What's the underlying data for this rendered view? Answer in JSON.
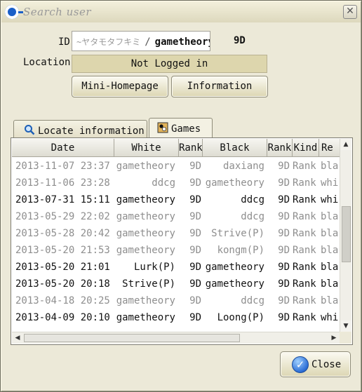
{
  "window": {
    "title": "Search user"
  },
  "user": {
    "id_label": "ID",
    "id_prefix": "~ヤタモタフキミ",
    "id_separator": "/",
    "username": "gametheory",
    "rank": "9D",
    "location_label": "Location",
    "location_value": "Not Logged in"
  },
  "buttons": {
    "mini_homepage": "Mini-Homepage",
    "information": "Information",
    "close": "Close"
  },
  "tabs": [
    {
      "label": "Locate information",
      "icon": "magnifier-icon",
      "active": false
    },
    {
      "label": "Games",
      "icon": "go-board-icon",
      "active": true
    }
  ],
  "table": {
    "columns": [
      "Date",
      "White",
      "Rank",
      "Black",
      "Rank",
      "Kind",
      "Re"
    ],
    "rows": [
      {
        "date": "2013-11-07 23:37",
        "white": "gametheory",
        "white_rank": "9D",
        "black": "daxiang",
        "black_rank": "9D",
        "kind": "Rank",
        "result": "bla",
        "dim": true
      },
      {
        "date": "2013-11-06 23:28",
        "white": "ddcg",
        "white_rank": "9D",
        "black": "gametheory",
        "black_rank": "9D",
        "kind": "Rank",
        "result": "whi",
        "dim": true
      },
      {
        "date": "2013-07-31 15:11",
        "white": "gametheory",
        "white_rank": "9D",
        "black": "ddcg",
        "black_rank": "9D",
        "kind": "Rank",
        "result": "whi",
        "dim": false
      },
      {
        "date": "2013-05-29 22:02",
        "white": "gametheory",
        "white_rank": "9D",
        "black": "ddcg",
        "black_rank": "9D",
        "kind": "Rank",
        "result": "bla",
        "dim": true
      },
      {
        "date": "2013-05-28 20:42",
        "white": "gametheory",
        "white_rank": "9D",
        "black": "Strive(P)",
        "black_rank": "9D",
        "kind": "Rank",
        "result": "bla",
        "dim": true
      },
      {
        "date": "2013-05-20 21:53",
        "white": "gametheory",
        "white_rank": "9D",
        "black": "kongm(P)",
        "black_rank": "9D",
        "kind": "Rank",
        "result": "bla",
        "dim": true
      },
      {
        "date": "2013-05-20 21:01",
        "white": "Lurk(P)",
        "white_rank": "9D",
        "black": "gametheory",
        "black_rank": "9D",
        "kind": "Rank",
        "result": "bla",
        "dim": false
      },
      {
        "date": "2013-05-20 20:18",
        "white": "Strive(P)",
        "white_rank": "9D",
        "black": "gametheory",
        "black_rank": "9D",
        "kind": "Rank",
        "result": "bla",
        "dim": false
      },
      {
        "date": "2013-04-18 20:25",
        "white": "gametheory",
        "white_rank": "9D",
        "black": "ddcg",
        "black_rank": "9D",
        "kind": "Rank",
        "result": "bla",
        "dim": true
      },
      {
        "date": "2013-04-09 20:10",
        "white": "gametheory",
        "white_rank": "9D",
        "black": "Loong(P)",
        "black_rank": "9D",
        "kind": "Rank",
        "result": "whi",
        "dim": false
      }
    ]
  },
  "colors": {
    "window_bg": "#ece9d8",
    "location_bg": "#ddd6ad",
    "accent": "#1b5fc8"
  }
}
